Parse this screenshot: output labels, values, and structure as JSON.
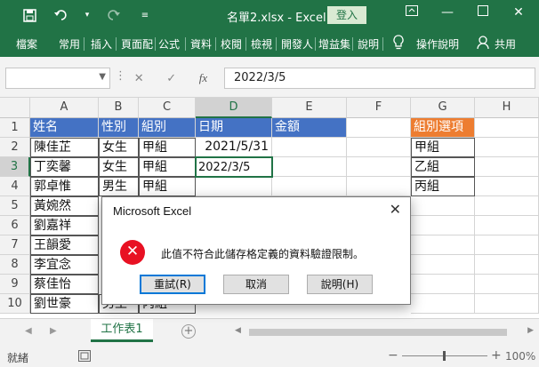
{
  "titlebar": {
    "title": "名單2.xlsx  -  Excel",
    "login_label": "登入",
    "save_icon": "save-icon",
    "undo_icon": "undo-icon",
    "redo_icon": "redo-icon",
    "customize_icon": "customize-qat-icon",
    "controls": [
      "ribbon-display-icon",
      "minimize-icon",
      "restore-icon",
      "close-icon"
    ]
  },
  "ribbon": {
    "tabs": [
      "檔案",
      "常用",
      "插入",
      "頁面配",
      "公式",
      "資料",
      "校閱",
      "檢視",
      "開發人",
      "增益集",
      "說明"
    ],
    "tell_me": "操作說明",
    "share": "共用"
  },
  "formula_bar": {
    "name_box": "",
    "cancel_icon": "✕",
    "enter_icon": "✓",
    "fx_label": "fx",
    "value": "2022/3/5"
  },
  "grid": {
    "columns": [
      "A",
      "B",
      "C",
      "D",
      "E",
      "F",
      "G",
      "H"
    ],
    "rows": [
      "1",
      "2",
      "3",
      "4",
      "5",
      "6",
      "7",
      "8",
      "9",
      "10"
    ],
    "header_row": [
      "姓名",
      "性別",
      "組別",
      "日期",
      "金額"
    ],
    "names": [
      "陳佳芷",
      "丁奕馨",
      "郭卓惟",
      "黃婉然",
      "劉嘉祥",
      "王韻愛",
      "李宜念",
      "蔡佳怡",
      "劉世豪"
    ],
    "gender": [
      "女生",
      "女生",
      "男生",
      "",
      "",
      "",
      "",
      "",
      "男生"
    ],
    "group": [
      "甲組",
      "甲組",
      "甲組",
      "",
      "",
      "",
      "",
      "",
      "丙組"
    ],
    "date_d2": "2021/5/31",
    "date_d3": "2022/3/5",
    "options_header": "組別選項",
    "options": [
      "甲組",
      "乙組",
      "丙組"
    ]
  },
  "sheets": {
    "active": "工作表1",
    "add_label": "+"
  },
  "statusbar": {
    "ready": "就緒",
    "zoom": "100%"
  },
  "dialog": {
    "title": "Microsoft Excel",
    "message": "此值不符合此儲存格定義的資料驗證限制。",
    "retry": "重試(R)",
    "cancel": "取消",
    "help": "說明(H)"
  }
}
